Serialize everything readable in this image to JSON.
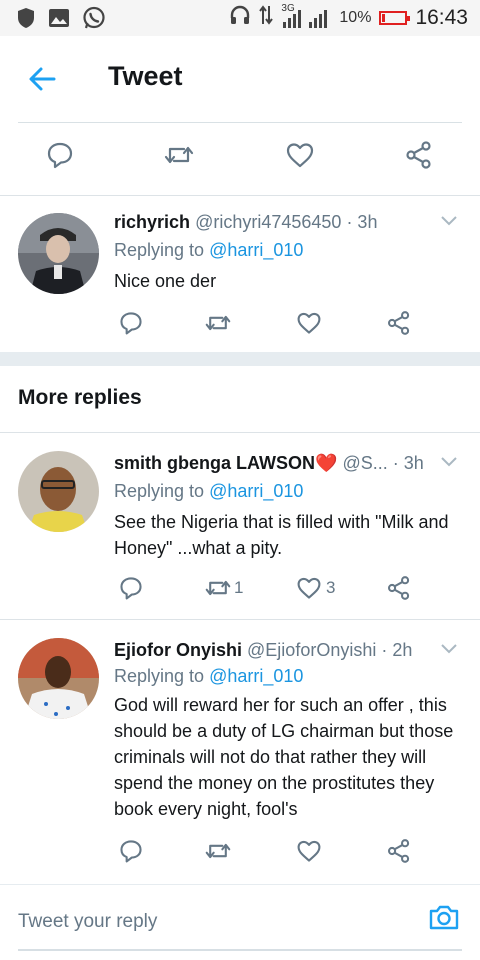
{
  "status_bar": {
    "network": "3G",
    "battery": "10%",
    "time": "16:43",
    "icons": [
      "shield-icon",
      "gallery-icon",
      "whatsapp-icon",
      "headphones-icon",
      "signal-icon"
    ]
  },
  "header": {
    "title": "Tweet",
    "back_icon": "arrow-left-icon"
  },
  "main_tweet_actions": [
    "reply-icon",
    "retweet-icon",
    "like-icon",
    "share-icon"
  ],
  "replies": [
    {
      "name": "richyrich",
      "handle": "@richyri47456450",
      "time": "· 3h",
      "replying_prefix": "Replying to ",
      "replying_to": "@harri_010",
      "text": "Nice one der",
      "retweets": "",
      "likes": ""
    }
  ],
  "more_replies": {
    "title": "More replies",
    "items": [
      {
        "name": "smith gbenga LAWSON",
        "emoji": "❤️",
        "handle": "@S...",
        "time": "· 3h",
        "replying_prefix": "Replying to ",
        "replying_to": "@harri_010",
        "text": "See the Nigeria that is filled with \"Milk and Honey\" ...what a pity.",
        "retweets": "1",
        "likes": "3"
      },
      {
        "name": "Ejiofor Onyishi",
        "handle": "@EjioforOnyishi",
        "time": "· 2h",
        "replying_prefix": "Replying to ",
        "replying_to": "@harri_010",
        "text": "God will reward her for such an offer , this should be a duty of LG chairman but those criminals will not do that rather they will spend the money on the prostitutes they book every night, fool's",
        "retweets": "",
        "likes": ""
      }
    ]
  },
  "compose": {
    "placeholder": "Tweet your reply",
    "camera_icon": "camera-icon"
  },
  "colors": {
    "accent": "#1da1f2",
    "mention": "#1b95e0",
    "muted": "#657786",
    "battery_low": "#e02020"
  }
}
